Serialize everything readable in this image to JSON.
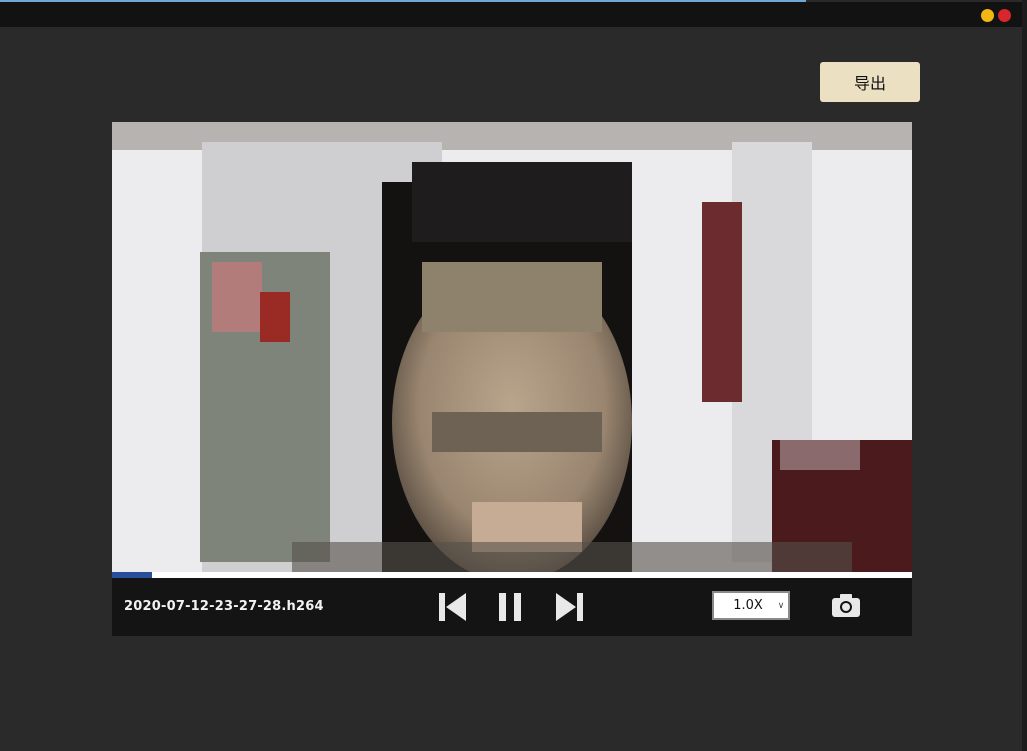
{
  "window": {
    "minimize_color": "#f2b615",
    "close_color": "#d8262d"
  },
  "toolbar": {
    "export_label": "导出"
  },
  "player": {
    "filename": "2020-07-12-23-27-28.h264",
    "progress": 0.05,
    "speed": "1.0X",
    "controls": [
      "skip-back-icon",
      "pause-icon",
      "skip-forward-icon",
      "camera-icon"
    ],
    "video_content": "pixelated webcam frame"
  }
}
